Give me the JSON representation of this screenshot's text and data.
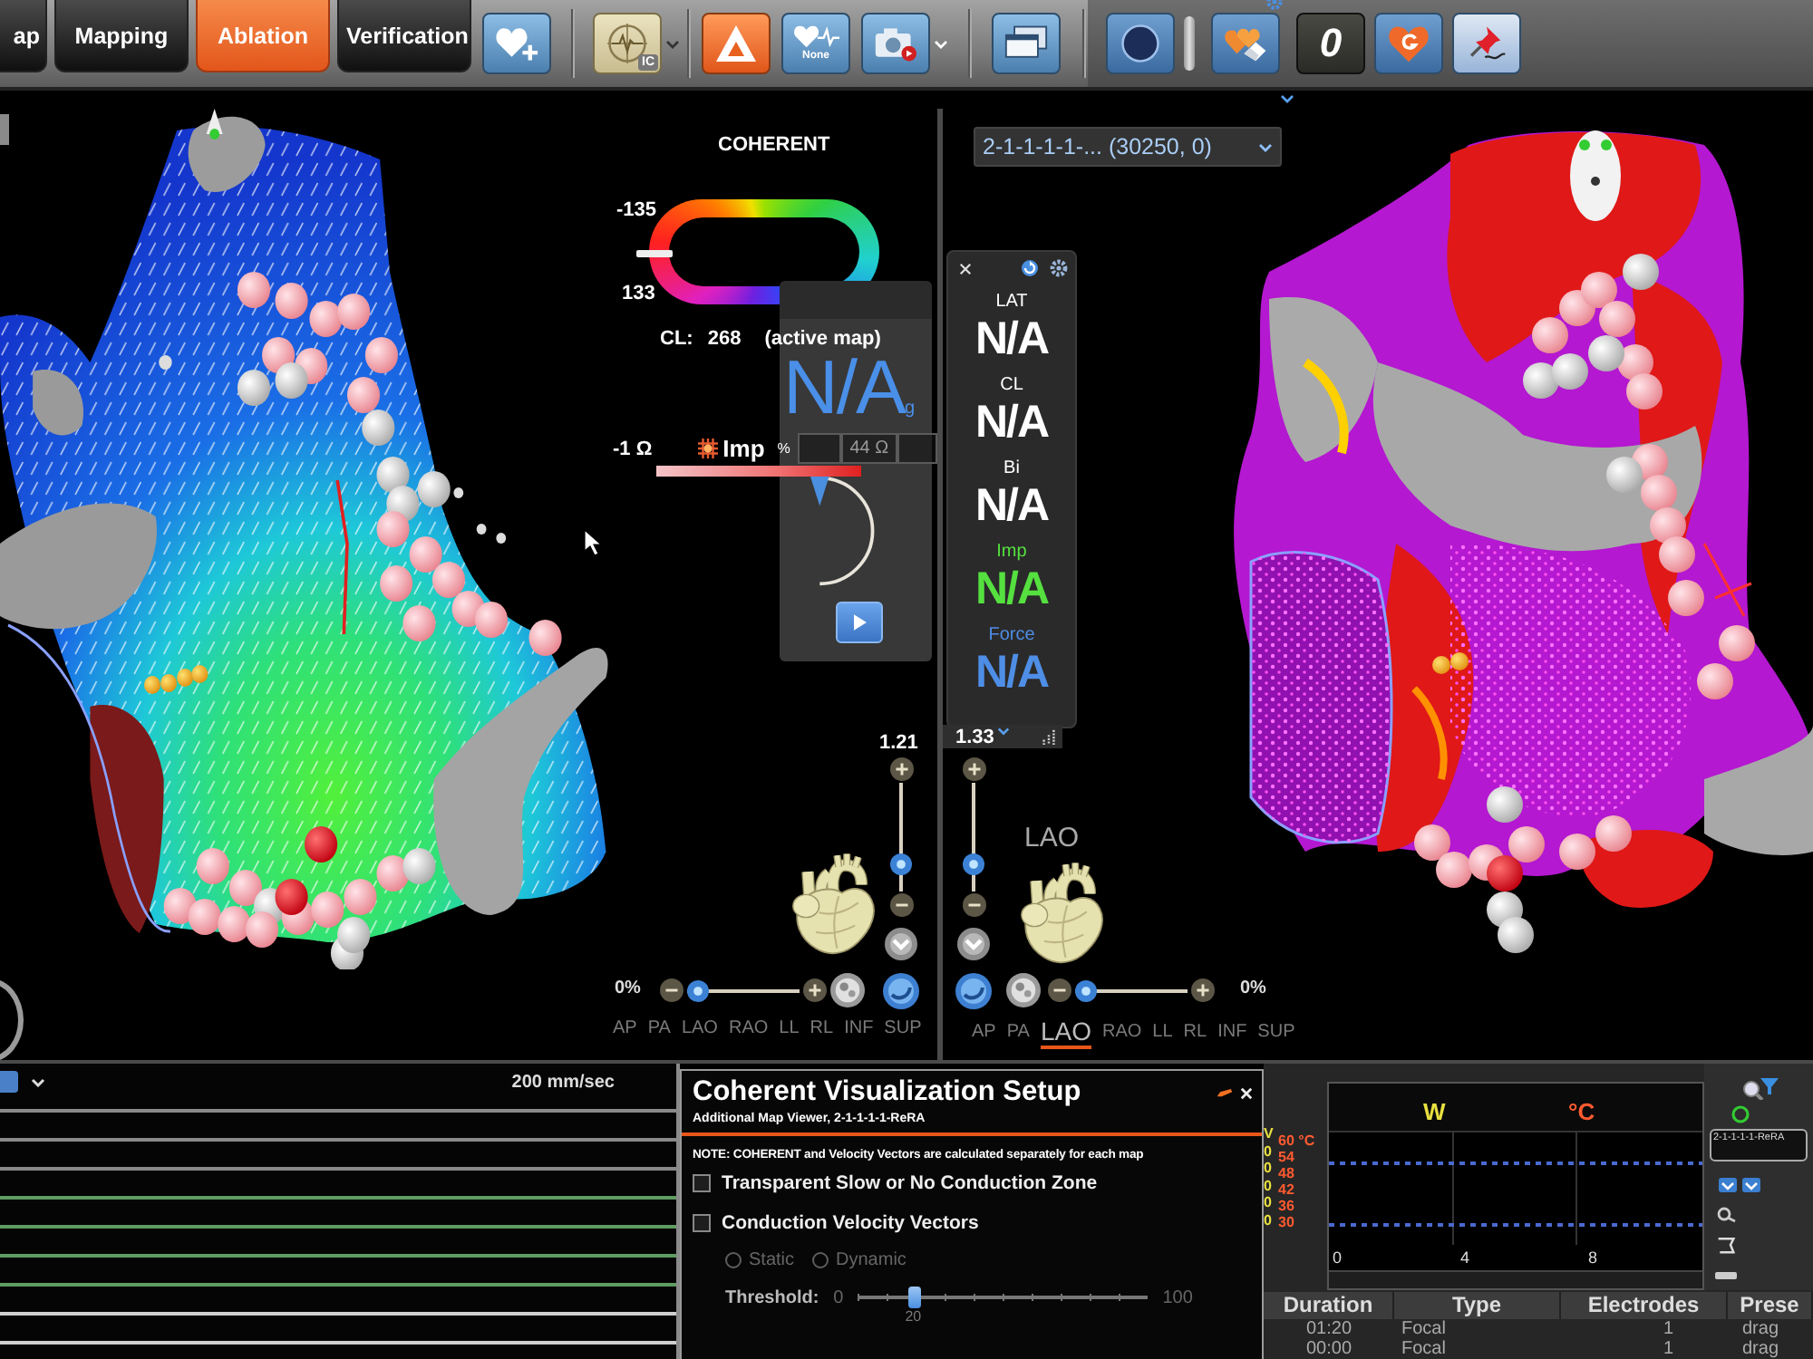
{
  "toolbar": {
    "tabs": [
      {
        "label": "ap",
        "selected": false
      },
      {
        "label": "Mapping",
        "selected": false
      },
      {
        "label": "Ablation",
        "selected": true
      },
      {
        "label": "Verification",
        "selected": false
      }
    ],
    "ic_badge": "IC",
    "tag_label": "None",
    "counter": "0"
  },
  "left_view": {
    "legend": {
      "title": "COHERENT",
      "top_value": "-135",
      "bottom_value": "133"
    },
    "cycle_length": {
      "label": "CL:",
      "value": "268",
      "note": "(active map)"
    },
    "impedance": {
      "low": "-1 Ω",
      "label": "Imp",
      "unit": "%",
      "high": "44 Ω"
    },
    "overlay_value": "N/A$_{g}$",
    "zoom": {
      "reading": "1.21",
      "level": 0.25
    },
    "transparency": {
      "reading": "0%",
      "level": 0.1
    },
    "views": [
      {
        "label": "AP",
        "selected": false
      },
      {
        "label": "PA",
        "selected": false
      },
      {
        "label": "LAO",
        "selected": false
      },
      {
        "label": "RAO",
        "selected": false
      },
      {
        "label": "LL",
        "selected": false
      },
      {
        "label": "RL",
        "selected": false
      },
      {
        "label": "INF",
        "selected": false
      },
      {
        "label": "SUP",
        "selected": false
      }
    ]
  },
  "right_view": {
    "map_selector": "2-1-1-1-1-... (30250, 0)",
    "readouts": [
      {
        "label": "LAT",
        "value": "N/A",
        "color": "#ffffff"
      },
      {
        "label": "CL",
        "value": "N/A",
        "color": "#ffffff"
      },
      {
        "label": "Bi",
        "value": "N/A",
        "color": "#ffffff"
      },
      {
        "label": "Imp",
        "value": "N/A",
        "color": "#55e040"
      },
      {
        "label": "Force",
        "value": "N/A",
        "color": "#4f8ee6"
      }
    ],
    "zoom": {
      "reading": "1.33",
      "level": 0.25
    },
    "orientation": "LAO",
    "transparency": {
      "reading": "0%",
      "level": 0.1
    },
    "views": [
      {
        "label": "AP",
        "selected": false
      },
      {
        "label": "PA",
        "selected": false
      },
      {
        "label": "LAO",
        "selected": true
      },
      {
        "label": "RAO",
        "selected": false
      },
      {
        "label": "LL",
        "selected": false
      },
      {
        "label": "RL",
        "selected": false
      },
      {
        "label": "INF",
        "selected": false
      },
      {
        "label": "SUP",
        "selected": false
      }
    ]
  },
  "ecg": {
    "sweep_speed": "200 mm/sec"
  },
  "coherent_setup": {
    "title": "Coherent Visualization Setup",
    "subtitle": "Additional Map Viewer, 2-1-1-1-1-ReRA",
    "note": "NOTE: COHERENT and Velocity Vectors are calculated separately for each map",
    "options": [
      {
        "label": "Transparent Slow or No Conduction Zone",
        "checked": false
      },
      {
        "label": "Conduction Velocity Vectors",
        "checked": false
      }
    ],
    "vector_modes": [
      {
        "label": "Static",
        "selected": false,
        "disabled": true
      },
      {
        "label": "Dynamic",
        "selected": false,
        "disabled": true
      }
    ],
    "threshold": {
      "label": "Threshold:",
      "min": "0",
      "max": "100",
      "value": "20",
      "level": 0.2
    }
  },
  "ablation_graph": {
    "power_label": "W",
    "temperature_label": "°C",
    "power_ticks": [
      "V",
      "0",
      "0",
      "0",
      "0",
      "0"
    ],
    "temperature_ticks": [
      "60 °C",
      "54",
      "48",
      "42",
      "36",
      "30"
    ],
    "time_ticks": [
      "0",
      "4",
      "8"
    ],
    "map_field": "2-1-1-1-1-ReRA"
  },
  "ablation_table": {
    "columns": [
      "Duration",
      "Type",
      "Electrodes",
      "Prese"
    ],
    "rows": [
      [
        "01:20",
        "Focal",
        "1",
        "drag"
      ],
      [
        "00:00",
        "Focal",
        "1",
        "drag"
      ]
    ]
  }
}
